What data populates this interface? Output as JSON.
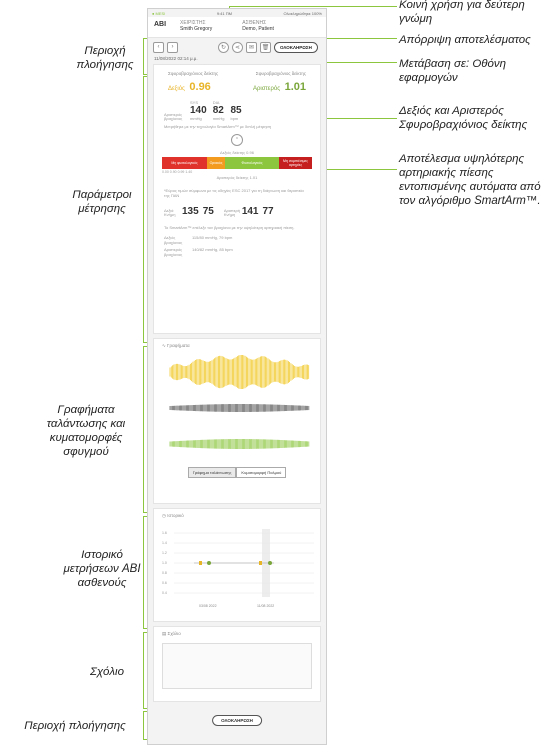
{
  "left_labels": {
    "nav_top": "Περιοχή πλοήγησης",
    "params": "Παράμετροι μέτρησης",
    "graphs": "Γραφήματα ταλάντωσης και κυματομορφές σφυγμού",
    "history": "Ιστορικό μετρήσεων ABI ασθενούς",
    "comment": "Σχόλιο",
    "nav_bottom": "Περιοχή πλοήγησης"
  },
  "right_labels": {
    "share": "Κοινή χρήση για δεύτερη γνώμη",
    "discard": "Απόρριψη αποτελέσματος",
    "goto": "Μετάβαση σε: Οθόνη εφαρμογών",
    "abi_desc": "Δεξιός και Αριστερός Σφυροβραχιόνιος δείκτης",
    "smartarm_desc": "Αποτέλεσμα υψηλότερης αρτηριακής πίεσης εντοπισμένης αυτόματα από τον αλγόριθμο SmartArm™."
  },
  "app": {
    "status_left": "● MESI",
    "status_time": "9:41 ΠΜ",
    "status_right": "Ολοκληρώθηκε  100%",
    "title": "ABI",
    "operator_label": "ΧΕΙΡΙΣΤΗΣ",
    "operator_value": "Smith Gregory",
    "patient_label": "ΑΣΘΕΝΗΣ",
    "patient_value": "Demo, Patient",
    "done_label": "ΟΛΟΚΛΗΡΩΣΗ",
    "date": "11/08/2022 02:14 μ.μ."
  },
  "params": {
    "right_index_label": "Σφυροβραχιόνιος δείκτης",
    "left_index_label": "Σφυροβραχιόνιος δείκτης",
    "right_side": "Δεξιός",
    "right_abi": "0.96",
    "left_side": "Αριστερός",
    "left_abi": "1.01",
    "arm_label": "Αριστερός βραχίονας",
    "sys_label": "SYS",
    "dia_label": "DIA",
    "arm_sys": "140",
    "arm_dia": "82",
    "arm_pulse": "85",
    "unit_mmhg": "mmHg",
    "unit_bpm": "bpm",
    "smartarm_note": "Μετρήθηκε με την τεχνολογία SmartArm™ με διπλή μέτρηση",
    "scale_top_label": "Δεξιός δείκτης 0.96",
    "scale_bottom_label": "Αριστερός δείκτης 1.01",
    "scale_bands": [
      "Μη φυσιολογικός",
      "Οριακός",
      "Φυσιολογικός",
      "Μη συμπιέσιμες αρτηρίες"
    ],
    "scale_ticks": "0.00  0.90  0.99  1.40",
    "ref_note": "*Εύρος τιμών σύμφωνα με τις οδηγίες ESC 2017 για τη διάγνωση και θεραπεία της ΠΑΝ",
    "right_ankle_label": "Δεξιά Κνήμη",
    "right_ankle_sys": "135",
    "right_ankle_dia": "75",
    "left_ankle_label": "Αριστερή Κνήμη",
    "left_ankle_sys": "141",
    "left_ankle_dia": "77",
    "smartarm_info": "Το SmartArm™ επέλεξε τον βραχίονα με την υψηλότερη αρτηριακή πίεση.",
    "right_arm_label": "Δεξιός βραχίονας",
    "right_arm_values": "115/80 mmHg, 79 bpm",
    "left_arm_label": "Αριστερός βραχίονας",
    "left_arm_values": "140/82 mmHg, 85 bpm"
  },
  "graphs": {
    "title": "Γραφήματα",
    "tab_osc": "Γράφημα ταλάντωσης",
    "tab_pulse": "Κυματομορφή Παλμού",
    "arm_caption": "Βραχίονας",
    "right_caption": "Δεξιά Κνήμη",
    "left_caption": "Αριστερή Κνήμη"
  },
  "history": {
    "title": "Ιστορικό",
    "y_ticks": [
      "1.6",
      "1.4",
      "1.2",
      "1.0",
      "0.8",
      "0.6",
      "0.4"
    ],
    "x_ticks": [
      "03/08 2022",
      "11/08 2022"
    ]
  },
  "comment": {
    "title": "Σχόλιο"
  },
  "footer": {
    "done_label": "ΟΛΟΚΛΗΡΩΣΗ"
  },
  "colors": {
    "accent": "#8cc63f",
    "abi_right": "#e8b428",
    "abi_left": "#7aa63a",
    "band_red": "#e0312a",
    "band_orange": "#f29b1f",
    "band_green": "#8cc63f",
    "band_darkred": "#c61f1f",
    "wave_yellow": "#f0c419",
    "wave_green": "#8cc63f"
  }
}
